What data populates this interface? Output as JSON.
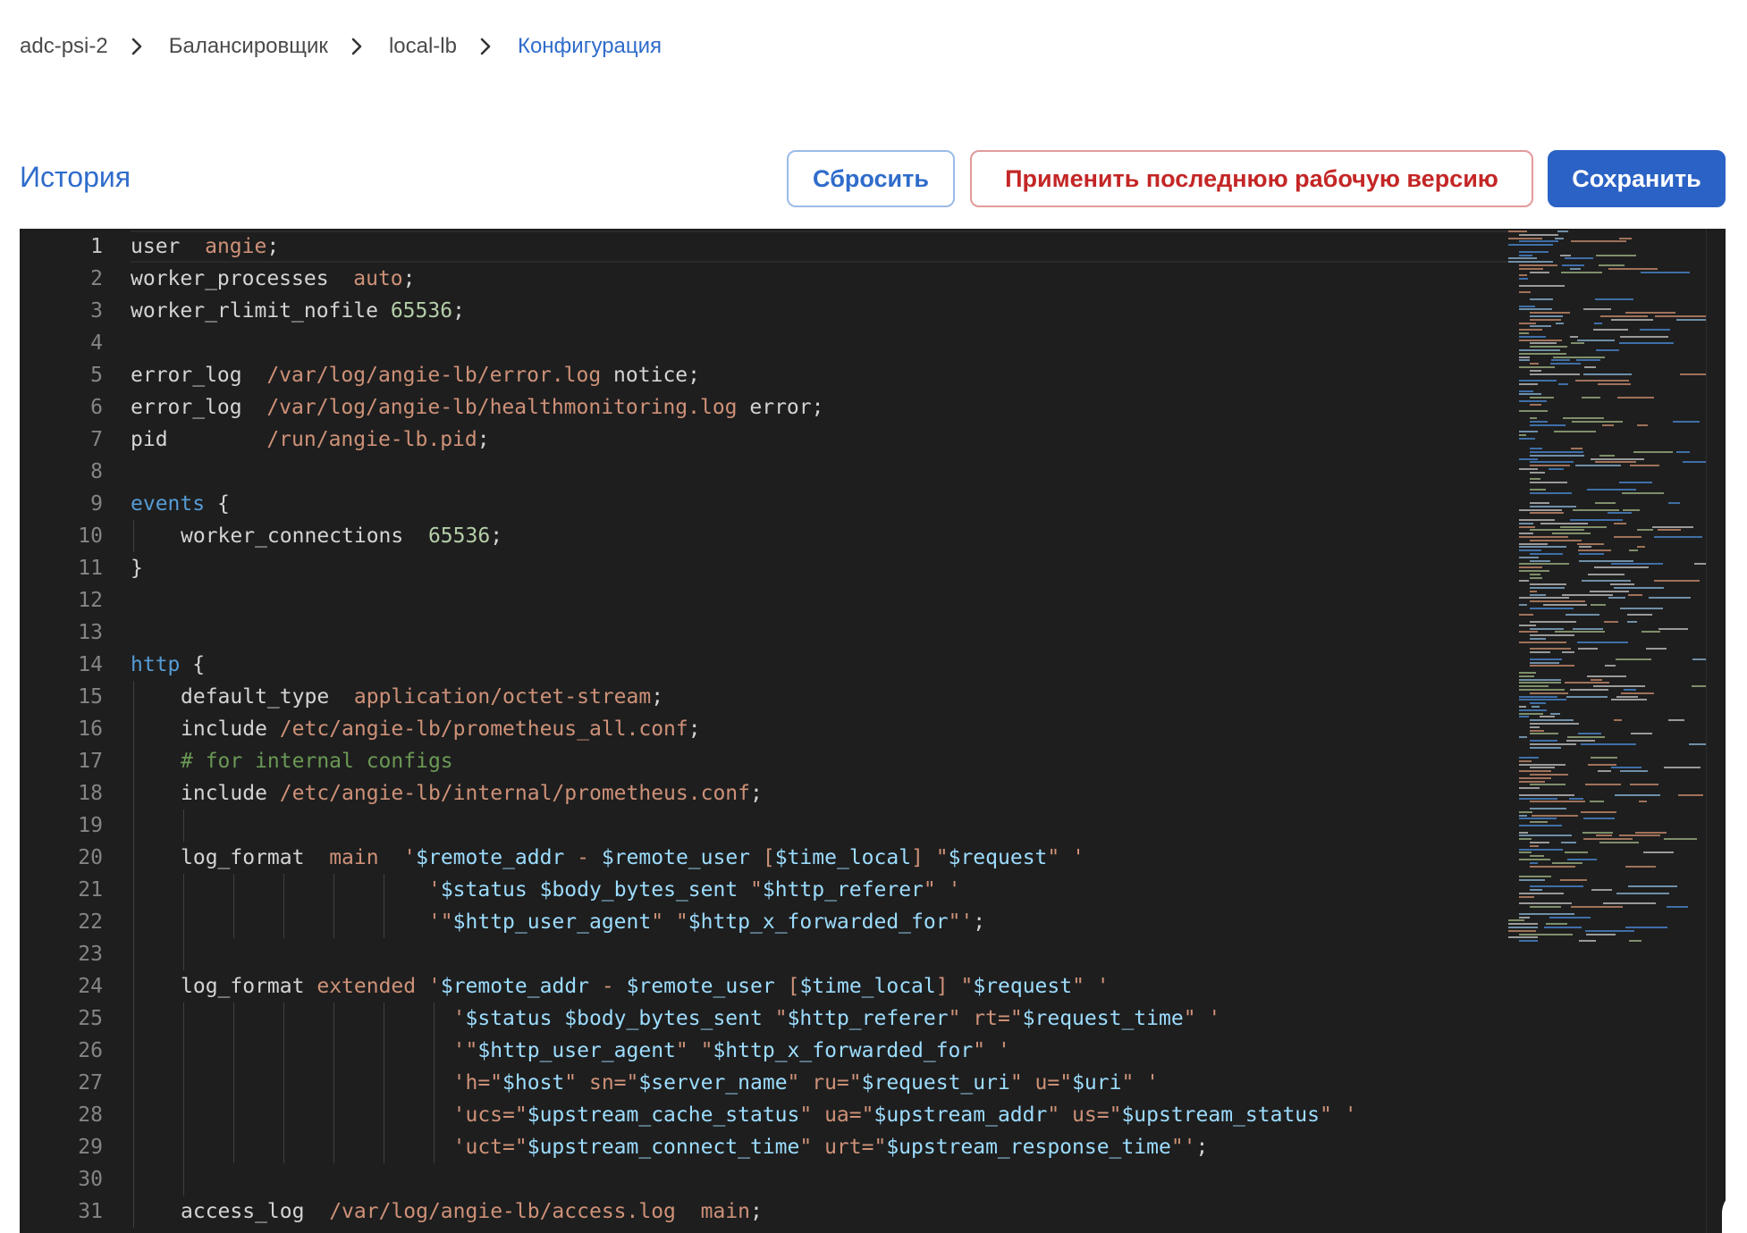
{
  "breadcrumb": {
    "items": [
      {
        "label": "adc-psi-2",
        "name": "crumb-adc-psi-2"
      },
      {
        "label": "Балансировщик",
        "name": "crumb-balancer"
      },
      {
        "label": "local-lb",
        "name": "crumb-local-lb"
      },
      {
        "label": "Конфигурация",
        "name": "crumb-configuration"
      }
    ]
  },
  "toolbar": {
    "history_label": "История",
    "reset_label": "Сбросить",
    "apply_last_label": "Применить последнюю рабочую версию",
    "save_label": "Сохранить"
  },
  "colors": {
    "accent": "#2f6ccb",
    "danger": "#c42626",
    "primary_button": "#2b62c5",
    "editor_background": "#1e1e1e"
  },
  "editor": {
    "active_line": 1,
    "lines": [
      {
        "n": "1",
        "indent": 0,
        "tokens": [
          [
            "user",
            "plain"
          ],
          [
            "  ",
            "plain"
          ],
          [
            "angie",
            "str"
          ],
          [
            ";",
            "plain"
          ]
        ]
      },
      {
        "n": "2",
        "indent": 0,
        "tokens": [
          [
            "worker_processes",
            "plain"
          ],
          [
            "  ",
            "plain"
          ],
          [
            "auto",
            "str"
          ],
          [
            ";",
            "plain"
          ]
        ]
      },
      {
        "n": "3",
        "indent": 0,
        "tokens": [
          [
            "worker_rlimit_nofile",
            "plain"
          ],
          [
            " ",
            "plain"
          ],
          [
            "65536",
            "num"
          ],
          [
            ";",
            "plain"
          ]
        ]
      },
      {
        "n": "4",
        "indent": 0,
        "tokens": []
      },
      {
        "n": "5",
        "indent": 0,
        "tokens": [
          [
            "error_log",
            "plain"
          ],
          [
            "  ",
            "plain"
          ],
          [
            "/var/log/angie-lb/error.log",
            "str"
          ],
          [
            " notice;",
            "plain"
          ]
        ]
      },
      {
        "n": "6",
        "indent": 0,
        "tokens": [
          [
            "error_log",
            "plain"
          ],
          [
            "  ",
            "plain"
          ],
          [
            "/var/log/angie-lb/healthmonitoring.log",
            "str"
          ],
          [
            " error;",
            "plain"
          ]
        ]
      },
      {
        "n": "7",
        "indent": 0,
        "tokens": [
          [
            "pid",
            "plain"
          ],
          [
            "        ",
            "plain"
          ],
          [
            "/run/angie-lb.pid",
            "str"
          ],
          [
            ";",
            "plain"
          ]
        ]
      },
      {
        "n": "8",
        "indent": 0,
        "tokens": []
      },
      {
        "n": "9",
        "indent": 0,
        "tokens": [
          [
            "events",
            "blue"
          ],
          [
            " {",
            "plain"
          ]
        ]
      },
      {
        "n": "10",
        "indent": 1,
        "tokens": [
          [
            "worker_connections",
            "plain"
          ],
          [
            "  ",
            "plain"
          ],
          [
            "65536",
            "num"
          ],
          [
            ";",
            "plain"
          ]
        ]
      },
      {
        "n": "11",
        "indent": 0,
        "tokens": [
          [
            "}",
            "plain"
          ]
        ]
      },
      {
        "n": "12",
        "indent": 0,
        "tokens": []
      },
      {
        "n": "13",
        "indent": 0,
        "tokens": []
      },
      {
        "n": "14",
        "indent": 0,
        "tokens": [
          [
            "http",
            "blue"
          ],
          [
            " {",
            "plain"
          ]
        ]
      },
      {
        "n": "15",
        "indent": 1,
        "tokens": [
          [
            "default_type",
            "plain"
          ],
          [
            "  ",
            "plain"
          ],
          [
            "application/octet-stream",
            "str"
          ],
          [
            ";",
            "plain"
          ]
        ]
      },
      {
        "n": "16",
        "indent": 1,
        "tokens": [
          [
            "include",
            "plain"
          ],
          [
            " ",
            "plain"
          ],
          [
            "/etc/angie-lb/prometheus_all.conf",
            "str"
          ],
          [
            ";",
            "plain"
          ]
        ]
      },
      {
        "n": "17",
        "indent": 1,
        "tokens": [
          [
            "# for internal configs",
            "com"
          ]
        ]
      },
      {
        "n": "18",
        "indent": 1,
        "tokens": [
          [
            "include",
            "plain"
          ],
          [
            " ",
            "plain"
          ],
          [
            "/etc/angie-lb/internal/prometheus.conf",
            "str"
          ],
          [
            ";",
            "plain"
          ]
        ]
      },
      {
        "n": "19",
        "indent": 1,
        "tokens": []
      },
      {
        "n": "20",
        "indent": 1,
        "tokens": [
          [
            "log_format",
            "plain"
          ],
          [
            "  ",
            "plain"
          ],
          [
            "main",
            "str"
          ],
          [
            "  ",
            "plain"
          ],
          [
            "'",
            "str"
          ],
          [
            "$remote_addr",
            "var"
          ],
          [
            " - ",
            "str"
          ],
          [
            "$remote_user",
            "var"
          ],
          [
            " [",
            "str"
          ],
          [
            "$time_local",
            "var"
          ],
          [
            "] \"",
            "str"
          ],
          [
            "$request",
            "var"
          ],
          [
            "\" '",
            "str"
          ]
        ]
      },
      {
        "n": "21",
        "indent": 1,
        "pad": "                    ",
        "guides": 5,
        "tokens": [
          [
            "'",
            "str"
          ],
          [
            "$status",
            "var"
          ],
          [
            " ",
            "str"
          ],
          [
            "$body_bytes_sent",
            "var"
          ],
          [
            " \"",
            "str"
          ],
          [
            "$http_referer",
            "var"
          ],
          [
            "\" '",
            "str"
          ]
        ]
      },
      {
        "n": "22",
        "indent": 1,
        "pad": "                    ",
        "guides": 5,
        "tokens": [
          [
            "'\"",
            "str"
          ],
          [
            "$http_user_agent",
            "var"
          ],
          [
            "\" \"",
            "str"
          ],
          [
            "$http_x_forwarded_for",
            "var"
          ],
          [
            "\"'",
            "str"
          ],
          [
            ";",
            "plain"
          ]
        ]
      },
      {
        "n": "23",
        "indent": 1,
        "tokens": []
      },
      {
        "n": "24",
        "indent": 1,
        "tokens": [
          [
            "log_format",
            "plain"
          ],
          [
            " ",
            "plain"
          ],
          [
            "extended",
            "str"
          ],
          [
            " ",
            "plain"
          ],
          [
            "'",
            "str"
          ],
          [
            "$remote_addr",
            "var"
          ],
          [
            " - ",
            "str"
          ],
          [
            "$remote_user",
            "var"
          ],
          [
            " [",
            "str"
          ],
          [
            "$time_local",
            "var"
          ],
          [
            "] \"",
            "str"
          ],
          [
            "$request",
            "var"
          ],
          [
            "\" '",
            "str"
          ]
        ]
      },
      {
        "n": "25",
        "indent": 1,
        "pad": "                      ",
        "guides": 6,
        "tokens": [
          [
            "'",
            "str"
          ],
          [
            "$status",
            "var"
          ],
          [
            " ",
            "str"
          ],
          [
            "$body_bytes_sent",
            "var"
          ],
          [
            " \"",
            "str"
          ],
          [
            "$http_referer",
            "var"
          ],
          [
            "\" rt=\"",
            "str"
          ],
          [
            "$request_time",
            "var"
          ],
          [
            "\" '",
            "str"
          ]
        ]
      },
      {
        "n": "26",
        "indent": 1,
        "pad": "                      ",
        "guides": 6,
        "tokens": [
          [
            "'\"",
            "str"
          ],
          [
            "$http_user_agent",
            "var"
          ],
          [
            "\" \"",
            "str"
          ],
          [
            "$http_x_forwarded_for",
            "var"
          ],
          [
            "\" '",
            "str"
          ]
        ]
      },
      {
        "n": "27",
        "indent": 1,
        "pad": "                      ",
        "guides": 6,
        "tokens": [
          [
            "'h=\"",
            "str"
          ],
          [
            "$host",
            "var"
          ],
          [
            "\" sn=\"",
            "str"
          ],
          [
            "$server_name",
            "var"
          ],
          [
            "\" ru=\"",
            "str"
          ],
          [
            "$request_uri",
            "var"
          ],
          [
            "\" u=\"",
            "str"
          ],
          [
            "$uri",
            "var"
          ],
          [
            "\" '",
            "str"
          ]
        ]
      },
      {
        "n": "28",
        "indent": 1,
        "pad": "                      ",
        "guides": 6,
        "tokens": [
          [
            "'ucs=\"",
            "str"
          ],
          [
            "$upstream_cache_status",
            "var"
          ],
          [
            "\" ua=\"",
            "str"
          ],
          [
            "$upstream_addr",
            "var"
          ],
          [
            "\" us=\"",
            "str"
          ],
          [
            "$upstream_status",
            "var"
          ],
          [
            "\" '",
            "str"
          ]
        ]
      },
      {
        "n": "29",
        "indent": 1,
        "pad": "                      ",
        "guides": 6,
        "tokens": [
          [
            "'uct=\"",
            "str"
          ],
          [
            "$upstream_connect_time",
            "var"
          ],
          [
            "\" urt=\"",
            "str"
          ],
          [
            "$upstream_response_time",
            "var"
          ],
          [
            "\"'",
            "str"
          ],
          [
            ";",
            "plain"
          ]
        ]
      },
      {
        "n": "30",
        "indent": 1,
        "tokens": []
      },
      {
        "n": "31",
        "indent": 1,
        "tokens": [
          [
            "access_log",
            "plain"
          ],
          [
            "  ",
            "plain"
          ],
          [
            "/var/log/angie-lb/access.log",
            "str"
          ],
          [
            "  ",
            "plain"
          ],
          [
            "main",
            "str"
          ],
          [
            ";",
            "plain"
          ]
        ]
      }
    ]
  }
}
